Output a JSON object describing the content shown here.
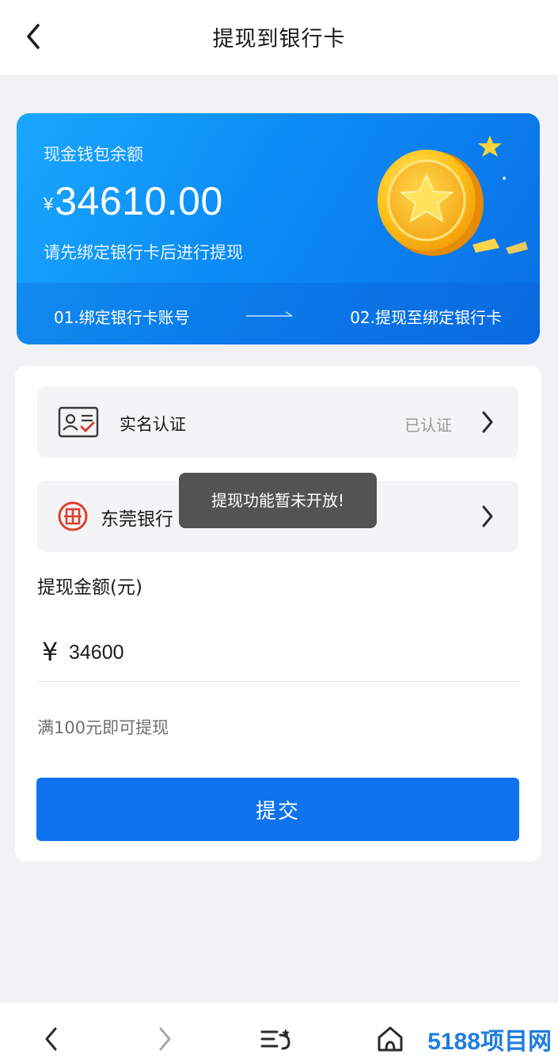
{
  "header": {
    "title": "提现到银行卡"
  },
  "balance_card": {
    "label": "现金钱包余额",
    "currency_symbol": "¥",
    "amount": "34610.00",
    "hint": "请先绑定银行卡后进行提现",
    "step1": "01.绑定银行卡账号",
    "step2": "02.提现至绑定银行卡"
  },
  "verification": {
    "label": "实名认证",
    "status": "已认证"
  },
  "bank": {
    "name": "东莞银行"
  },
  "withdraw": {
    "title": "提现金额(元)",
    "currency_symbol": "¥",
    "amount_value": "34600",
    "min_hint": "满100元即可提现",
    "submit_label": "提交"
  },
  "toast": {
    "message": "提现功能暂未开放!"
  },
  "watermark": "5188项目网",
  "colors": {
    "accent": "#0f73f0",
    "card_start": "#1aa7ff",
    "card_end": "#0a6fe6",
    "bank_logo": "#d9432f"
  },
  "icons": {
    "header_back": "chevron-left-icon",
    "verify": "id-card-icon",
    "bank": "bank-logo-icon",
    "row_arrow": "chevron-right-icon",
    "bottom": [
      "chevron-left-icon",
      "chevron-right-icon",
      "menu-icon",
      "home-icon"
    ]
  }
}
